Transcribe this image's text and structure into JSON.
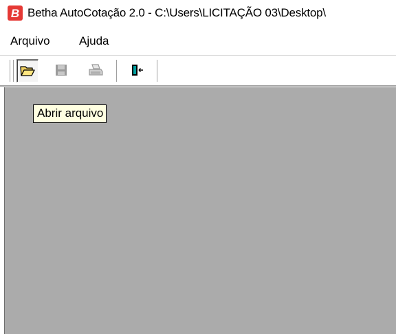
{
  "window": {
    "title": "Betha AutoCotação 2.0 - C:\\Users\\LICITAÇÃO 03\\Desktop\\",
    "icon": "betha-logo-icon",
    "icon_letter": "B",
    "accent": "#e53935"
  },
  "menu": {
    "items": [
      {
        "label": "Arquivo"
      },
      {
        "label": "Ajuda"
      }
    ]
  },
  "toolbar": {
    "buttons": [
      {
        "icon": "open-folder-icon",
        "state": "pressed",
        "enabled": true
      },
      {
        "icon": "save-disk-icon",
        "state": "normal",
        "enabled": false
      },
      {
        "icon": "printer-icon",
        "state": "normal",
        "enabled": false
      },
      {
        "icon": "exit-door-icon",
        "state": "normal",
        "enabled": true
      }
    ]
  },
  "tooltip": {
    "text": "Abrir arquivo"
  },
  "colors": {
    "workspace": "#ababab",
    "tooltip_bg": "#ffffe1"
  }
}
